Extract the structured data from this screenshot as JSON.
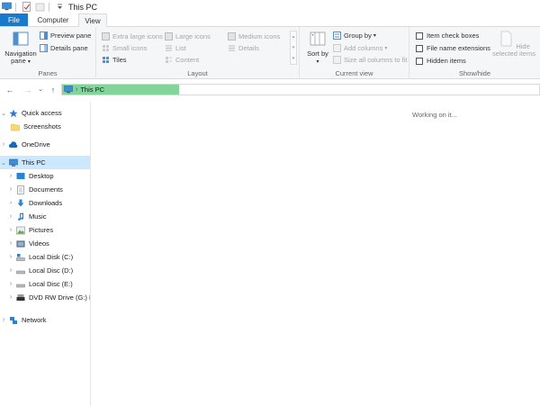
{
  "window": {
    "title": "This PC"
  },
  "tabs": [
    {
      "label": "File"
    },
    {
      "label": "Computer"
    },
    {
      "label": "View"
    }
  ],
  "ribbon": {
    "panes": {
      "navigation_pane": "Navigation pane",
      "preview_pane": "Preview pane",
      "details_pane": "Details pane",
      "group_label": "Panes"
    },
    "layout": {
      "extra_large_icons": "Extra large icons",
      "large_icons": "Large icons",
      "medium_icons": "Medium icons",
      "small_icons": "Small icons",
      "list": "List",
      "details": "Details",
      "tiles": "Tiles",
      "content": "Content",
      "group_label": "Layout"
    },
    "current_view": {
      "sort_by": "Sort by",
      "group_by": "Group by",
      "add_columns": "Add columns",
      "size_all_columns": "Size all columns to fit",
      "group_label": "Current view"
    },
    "show_hide": {
      "item_check_boxes": "Item check boxes",
      "file_name_extensions": "File name extensions",
      "hidden_items": "Hidden items",
      "hide_selected_items": "Hide selected items",
      "group_label": "Show/hide"
    }
  },
  "address": {
    "path": "This PC"
  },
  "nav_tree": [
    {
      "label": "Quick access",
      "icon": "star-icon"
    },
    {
      "label": "Screenshots",
      "icon": "folder-icon"
    },
    {
      "label": "OneDrive",
      "icon": "cloud-icon"
    },
    {
      "label": "This PC",
      "icon": "computer-icon"
    },
    {
      "label": "Desktop",
      "icon": "desktop-icon"
    },
    {
      "label": "Documents",
      "icon": "documents-icon"
    },
    {
      "label": "Downloads",
      "icon": "downloads-icon"
    },
    {
      "label": "Music",
      "icon": "music-icon"
    },
    {
      "label": "Pictures",
      "icon": "pictures-icon"
    },
    {
      "label": "Videos",
      "icon": "videos-icon"
    },
    {
      "label": "Local Disk (C:)",
      "icon": "disk-icon"
    },
    {
      "label": "Local Disc (D:)",
      "icon": "disk-icon"
    },
    {
      "label": "Local Disc (E:)",
      "icon": "disk-icon"
    },
    {
      "label": "DVD RW Drive (G:) M",
      "icon": "dvd-icon"
    },
    {
      "label": "Network",
      "icon": "network-icon"
    }
  ],
  "content": {
    "status": "Working on it..."
  },
  "colors": {
    "file_tab": "#1979ca",
    "progress_fill": "#82d49a",
    "selection": "#cce8ff"
  }
}
